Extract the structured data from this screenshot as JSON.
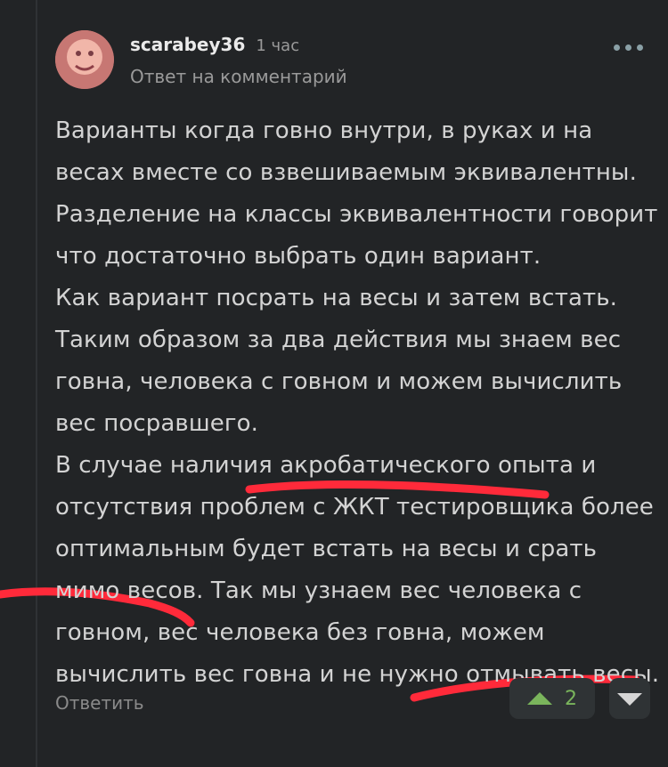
{
  "comment": {
    "author": "scarabey36",
    "time": "1 час",
    "subtitle": "Ответ на комментарий",
    "body_lines": [
      "Варианты когда говно внутри, в руках и на",
      "весах вместе со взвешиваемым эквивалентны.",
      "Разделение на классы эквивалентности говорит",
      "что достаточно выбрать один вариант.",
      "Как вариант посрать на весы и затем встать.",
      "Таким образом за два действия мы знаем вес",
      "говна, человека с говном и можем вычислить",
      "вес посравшего.",
      "В случае наличия акробатического опыта и",
      "отсутствия проблем с ЖКТ тестировщика более",
      "оптимальным будет встать на весы и срать",
      "мимо весов. Так мы узнаем вес человека с",
      "говном, вес человека без говна, можем",
      "вычислить вес говна и не нужно отмывать весы."
    ],
    "reply_label": "Ответить",
    "votes": "2"
  },
  "colors": {
    "background": "#222426",
    "text": "#d3d3d3",
    "muted": "#9a9a9a",
    "accent_green": "#7ab55c",
    "annotation_red": "#ff2a3a"
  },
  "icons": {
    "more": "more-dots-icon",
    "upvote": "triangle-up-icon",
    "downvote": "triangle-down-icon"
  }
}
